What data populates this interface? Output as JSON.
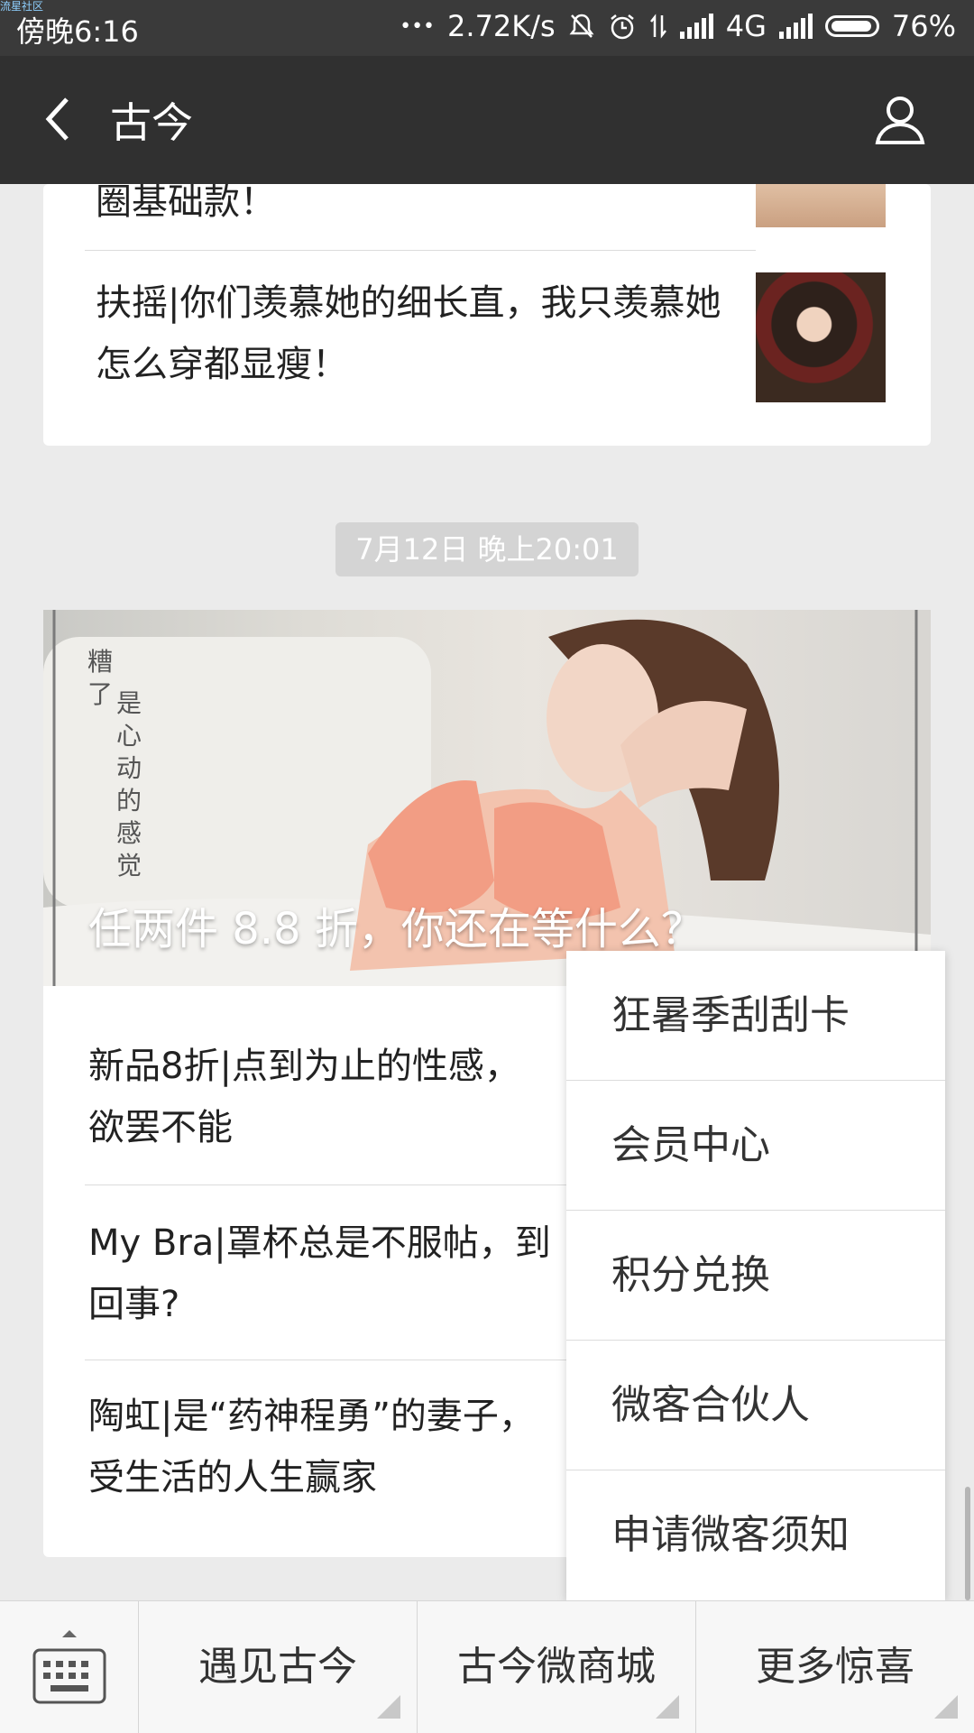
{
  "status_bar": {
    "watermark": "流星社区",
    "time": "傍晚6:16",
    "dots": "•••",
    "speed": "2.72K/s",
    "network": "4G",
    "battery": "76%"
  },
  "nav": {
    "title": "古今"
  },
  "articles_top": [
    {
      "title": "圈基础款！"
    },
    {
      "title": "扶摇|你们羡慕她的细长直，我只羡慕她怎么穿都显瘦！"
    }
  ],
  "timestamp": "7月12日 晚上20:01",
  "cover": {
    "title": "任两件 8.8 折，你还在等什么？",
    "vertical_text_1": "糟了",
    "vertical_text_2": "是心动的感觉"
  },
  "articles": [
    {
      "line1": "新品8折|点到为止的性感，",
      "line2": "欲罢不能"
    },
    {
      "line1": "My Bra|罩杯总是不服帖，到",
      "line2": "回事?"
    },
    {
      "line1": "陶虹|是“药神程勇”的妻子，",
      "line2": "受生活的人生赢家"
    }
  ],
  "popup_menu": {
    "items": [
      "狂暑季刮刮卡",
      "会员中心",
      "积分兑换",
      "微客合伙人",
      "申请微客须知"
    ]
  },
  "bottom_menu": {
    "items": [
      "遇见古今",
      "古今微商城",
      "更多惊喜"
    ]
  }
}
